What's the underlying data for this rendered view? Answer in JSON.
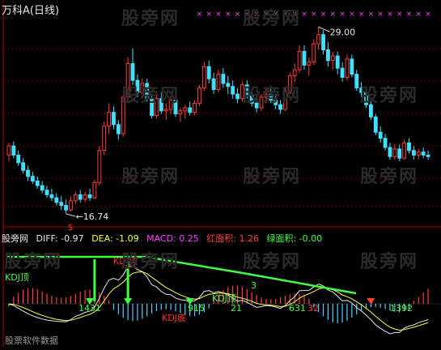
{
  "title": "万科A(日线)",
  "watermark": "股旁网",
  "price_panel": {
    "high_label": "29.00",
    "low_label": "16.74",
    "low_marker": "$",
    "colors": {
      "up": "#ff3b3b",
      "down": "#40e0ff",
      "grid": "#7a0000",
      "marker": "#ff40ff"
    }
  },
  "indicator_panel": {
    "source": "股旁网",
    "diff": {
      "label": "DIFF: -0.97",
      "color": "#e6e6e6"
    },
    "dea": {
      "label": "DEA: -1.09",
      "color": "#ffff40"
    },
    "macd": {
      "label": "MACD: 0.25",
      "color": "#ff40ff"
    },
    "red_area": {
      "label": "红面积: 1.26",
      "color": "#ff4040"
    },
    "green_area": {
      "label": "绿面积: -0.00",
      "color": "#40ff40"
    },
    "labels": [
      {
        "text": "KDJ顶",
        "color": "#40ff40"
      },
      {
        "text": "KDJ顶",
        "color": "#ff3030"
      },
      {
        "text": "KDJ顶",
        "color": "#40ff40"
      },
      {
        "text": "KDJ底",
        "color": "#ff3030"
      },
      {
        "text": "1431",
        "color": "#40ff40"
      },
      {
        "text": "915",
        "color": "#40ff40"
      },
      {
        "text": "631",
        "color": "#40ff40"
      },
      {
        "text": "32",
        "color": "#ff4040"
      },
      {
        "text": "1392",
        "color": "#40ff40"
      },
      {
        "text": "3",
        "color": "#40ff40"
      },
      {
        "text": "21",
        "color": "#40ff40"
      }
    ],
    "footer": "股票软件数据"
  },
  "chart_data": {
    "type": "candlestick",
    "title": "万科A(日线)",
    "high": 29.0,
    "low": 16.74,
    "candles": [
      [
        20.6,
        21.4,
        20.2,
        21.2
      ],
      [
        21.2,
        21.5,
        20.4,
        20.6
      ],
      [
        20.6,
        20.9,
        19.9,
        20.1
      ],
      [
        20.1,
        20.4,
        19.4,
        19.6
      ],
      [
        19.6,
        19.9,
        18.9,
        19.2
      ],
      [
        19.2,
        19.5,
        18.7,
        18.9
      ],
      [
        18.9,
        19.2,
        18.4,
        18.6
      ],
      [
        18.6,
        18.9,
        18.1,
        18.3
      ],
      [
        18.3,
        18.6,
        17.8,
        18.0
      ],
      [
        18.0,
        18.4,
        17.6,
        17.8
      ],
      [
        17.8,
        18.1,
        17.3,
        17.5
      ],
      [
        17.5,
        17.9,
        17.0,
        17.3
      ],
      [
        17.3,
        17.7,
        16.74,
        17.0
      ],
      [
        17.0,
        17.9,
        16.9,
        17.6
      ],
      [
        17.6,
        18.2,
        17.4,
        18.0
      ],
      [
        18.0,
        18.3,
        17.5,
        17.7
      ],
      [
        17.7,
        18.2,
        17.5,
        18.0
      ],
      [
        18.0,
        18.4,
        17.6,
        17.8
      ],
      [
        17.8,
        19.0,
        17.7,
        18.8
      ],
      [
        18.8,
        21.2,
        18.6,
        20.9
      ],
      [
        20.9,
        22.8,
        20.6,
        22.5
      ],
      [
        22.5,
        24.0,
        22.0,
        23.4
      ],
      [
        23.4,
        23.8,
        22.3,
        22.6
      ],
      [
        22.6,
        22.9,
        21.6,
        22.0
      ],
      [
        22.0,
        24.6,
        21.8,
        24.4
      ],
      [
        24.4,
        27.0,
        24.0,
        26.6
      ],
      [
        26.6,
        27.6,
        25.2,
        25.5
      ],
      [
        25.5,
        25.9,
        24.4,
        24.7
      ],
      [
        24.7,
        25.6,
        24.3,
        25.3
      ],
      [
        25.3,
        25.6,
        24.1,
        24.3
      ],
      [
        24.3,
        24.6,
        23.0,
        23.2
      ],
      [
        23.2,
        24.6,
        23.0,
        24.3
      ],
      [
        24.3,
        24.7,
        23.3,
        23.5
      ],
      [
        23.5,
        24.0,
        22.9,
        23.6
      ],
      [
        23.6,
        24.5,
        23.3,
        24.2
      ],
      [
        24.2,
        24.5,
        23.1,
        23.3
      ],
      [
        23.3,
        23.7,
        22.8,
        23.5
      ],
      [
        23.5,
        23.9,
        23.0,
        23.7
      ],
      [
        23.7,
        24.1,
        23.2,
        23.4
      ],
      [
        23.4,
        24.2,
        23.2,
        24.0
      ],
      [
        24.0,
        25.2,
        23.8,
        25.0
      ],
      [
        25.0,
        26.7,
        24.8,
        26.4
      ],
      [
        26.4,
        26.8,
        25.3,
        25.6
      ],
      [
        25.6,
        26.0,
        24.6,
        24.9
      ],
      [
        24.9,
        26.2,
        24.7,
        25.9
      ],
      [
        25.9,
        26.3,
        25.0,
        25.3
      ],
      [
        25.3,
        25.8,
        24.6,
        25.1
      ],
      [
        25.1,
        25.5,
        24.3,
        24.6
      ],
      [
        24.6,
        25.0,
        24.0,
        24.3
      ],
      [
        24.3,
        25.4,
        24.1,
        25.2
      ],
      [
        25.2,
        25.5,
        24.3,
        24.5
      ],
      [
        24.5,
        24.9,
        23.8,
        24.0
      ],
      [
        24.0,
        24.3,
        23.4,
        23.7
      ],
      [
        23.7,
        24.6,
        23.5,
        24.4
      ],
      [
        24.4,
        25.0,
        24.0,
        24.6
      ],
      [
        24.6,
        25.0,
        24.0,
        24.2
      ],
      [
        24.2,
        24.6,
        23.6,
        23.9
      ],
      [
        23.9,
        24.2,
        23.3,
        23.6
      ],
      [
        23.6,
        25.0,
        23.5,
        24.8
      ],
      [
        24.8,
        26.0,
        24.6,
        25.8
      ],
      [
        25.8,
        26.6,
        25.4,
        26.2
      ],
      [
        26.2,
        27.8,
        26.0,
        27.4
      ],
      [
        27.4,
        27.8,
        26.2,
        26.5
      ],
      [
        26.5,
        27.0,
        25.8,
        26.7
      ],
      [
        26.7,
        28.2,
        26.5,
        27.9
      ],
      [
        27.9,
        29.0,
        27.5,
        28.5
      ],
      [
        28.5,
        28.8,
        27.2,
        27.5
      ],
      [
        27.5,
        28.0,
        26.4,
        26.8
      ],
      [
        26.8,
        27.4,
        26.2,
        27.1
      ],
      [
        27.1,
        27.4,
        25.9,
        26.3
      ],
      [
        26.3,
        26.7,
        25.4,
        25.7
      ],
      [
        25.7,
        27.2,
        25.5,
        26.9
      ],
      [
        26.9,
        27.2,
        25.7,
        25.9
      ],
      [
        25.9,
        26.2,
        24.8,
        25.0
      ],
      [
        25.0,
        25.4,
        24.4,
        24.7
      ],
      [
        24.7,
        25.0,
        23.7,
        23.9
      ],
      [
        23.9,
        24.2,
        22.9,
        23.1
      ],
      [
        23.1,
        23.3,
        21.9,
        22.1
      ],
      [
        22.1,
        22.5,
        21.4,
        21.7
      ],
      [
        21.7,
        22.0,
        20.9,
        21.1
      ],
      [
        21.1,
        21.4,
        20.3,
        20.5
      ],
      [
        20.5,
        21.3,
        20.3,
        21.0
      ],
      [
        21.0,
        21.3,
        20.2,
        20.4
      ],
      [
        20.4,
        21.6,
        20.3,
        21.4
      ],
      [
        21.4,
        21.7,
        20.7,
        20.9
      ],
      [
        20.9,
        21.2,
        20.3,
        20.6
      ],
      [
        20.6,
        21.0,
        20.3,
        20.8
      ],
      [
        20.8,
        21.1,
        20.4,
        20.6
      ],
      [
        20.6,
        20.9,
        20.3,
        20.5
      ]
    ]
  }
}
